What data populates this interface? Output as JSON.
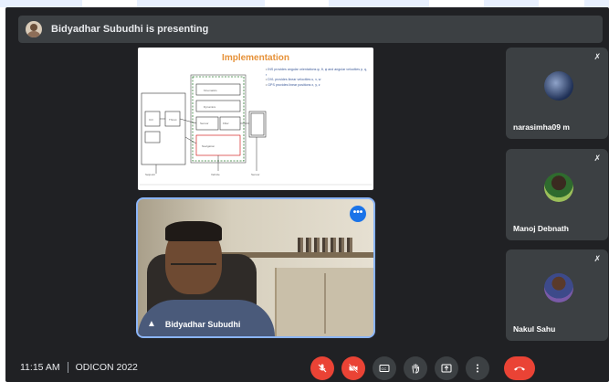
{
  "presenting_bar": {
    "title": "Bidyadhar Subudhi is presenting"
  },
  "slide": {
    "title": "Implementation",
    "bullets": [
      "INS provides angular orientations φ, θ, ψ and angular velocities p, q, r",
      "DVL provides linear velocities u, v, w",
      "GPS provides linear positions x, y, z"
    ]
  },
  "presenter_tile": {
    "name": "Bidyadhar Subudhi"
  },
  "participants": [
    {
      "name": "narasimha09 m"
    },
    {
      "name": "Manoj Debnath"
    },
    {
      "name": "Nakul Sahu"
    }
  ],
  "bottom_bar": {
    "time": "11:15 AM",
    "meeting_name": "ODICON 2022"
  },
  "controls": [
    "mic-off-icon",
    "camera-off-icon",
    "captions-icon",
    "raise-hand-icon",
    "present-icon",
    "more-options-icon",
    "hang-up-icon"
  ],
  "colors": {
    "background": "#202124",
    "tile": "#3c4043",
    "danger": "#ea4335",
    "accent": "#1a73e8",
    "slide_title": "#e69138"
  }
}
